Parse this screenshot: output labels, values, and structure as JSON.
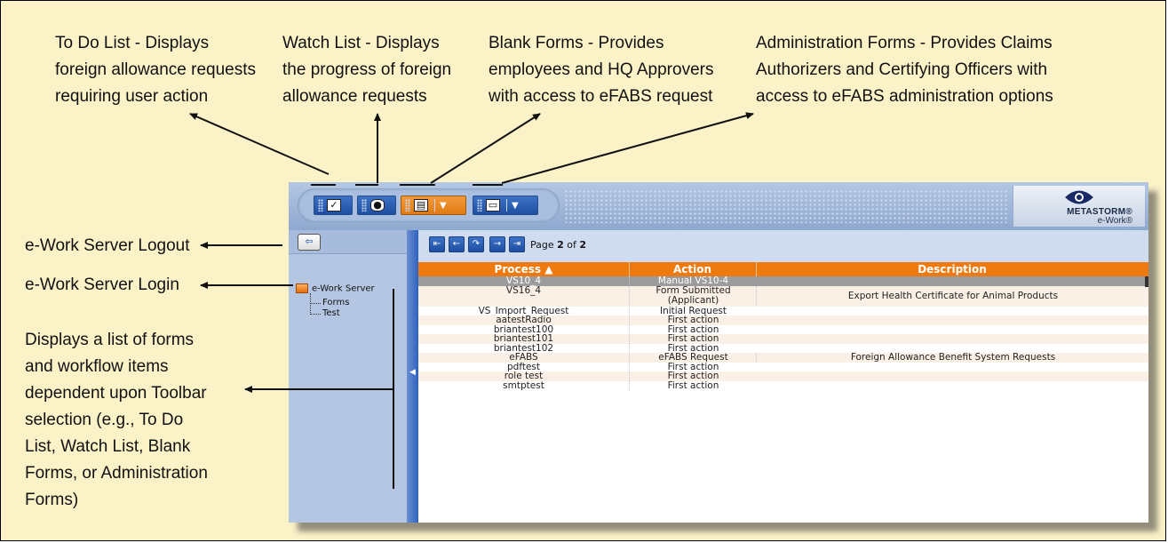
{
  "annotations": {
    "todo": [
      "To Do List - Displays",
      "foreign allowance requests",
      "requiring user action"
    ],
    "watch": [
      "Watch List - Displays",
      "the progress of foreign",
      "allowance requests"
    ],
    "blank": [
      "Blank Forms - Provides",
      "employees and HQ Approvers",
      "with access to eFABS request"
    ],
    "admin": [
      "Administration Forms - Provides Claims",
      "Authorizers and Certifying Officers with",
      "access to eFABS administration options"
    ],
    "logout": "e-Work Server Logout",
    "login": "e-Work Server Login",
    "list": [
      "Displays a list of forms",
      "and workflow items",
      "dependent upon Toolbar",
      "selection (e.g., To Do",
      "List, Watch List, Blank",
      "Forms, or Administration",
      "Forms)"
    ]
  },
  "toolbar": {
    "buttons": [
      {
        "name": "todo-list-button",
        "icon": "checkbox-icon"
      },
      {
        "name": "watch-list-button",
        "icon": "eye-icon"
      },
      {
        "name": "blank-forms-button",
        "icon": "forms-icon",
        "active": true
      },
      {
        "name": "administration-forms-button",
        "icon": "folder-icon"
      }
    ],
    "logo_brand": "METASTORM®",
    "logo_sub": "e-Work®"
  },
  "tree": {
    "root": "e-Work Server",
    "children": [
      "Forms",
      "Test"
    ]
  },
  "pager": {
    "prefix": "Page",
    "current": "2",
    "sep": "of",
    "total": "2"
  },
  "grid": {
    "headers": [
      "Process ▲",
      "Action",
      "Description"
    ],
    "rows": [
      {
        "process": "VS10_4",
        "action": "Manual VS10-4",
        "description": "",
        "selected": true
      },
      {
        "process": "VS16_4",
        "action": "Form Submitted\n(Applicant)",
        "description": "Export Health Certificate for Animal Products"
      },
      {
        "process": "VS_Import_Request",
        "action": "Initial Request",
        "description": ""
      },
      {
        "process": "aatestRadio",
        "action": "First action",
        "description": ""
      },
      {
        "process": "briantest100",
        "action": "First action",
        "description": ""
      },
      {
        "process": "briantest101",
        "action": "First action",
        "description": ""
      },
      {
        "process": "briantest102",
        "action": "First action",
        "description": ""
      },
      {
        "process": "eFABS",
        "action": "eFABS Request",
        "description": "Foreign Allowance Benefit System Requests"
      },
      {
        "process": "pdftest",
        "action": "First action",
        "description": ""
      },
      {
        "process": "role test",
        "action": "First action",
        "description": ""
      },
      {
        "process": "smtptest",
        "action": "First action",
        "description": ""
      }
    ]
  },
  "colors": {
    "background": "#fcf2c8",
    "accent_orange": "#ee7a0f",
    "toolbar_blue": "#2e62c0"
  }
}
